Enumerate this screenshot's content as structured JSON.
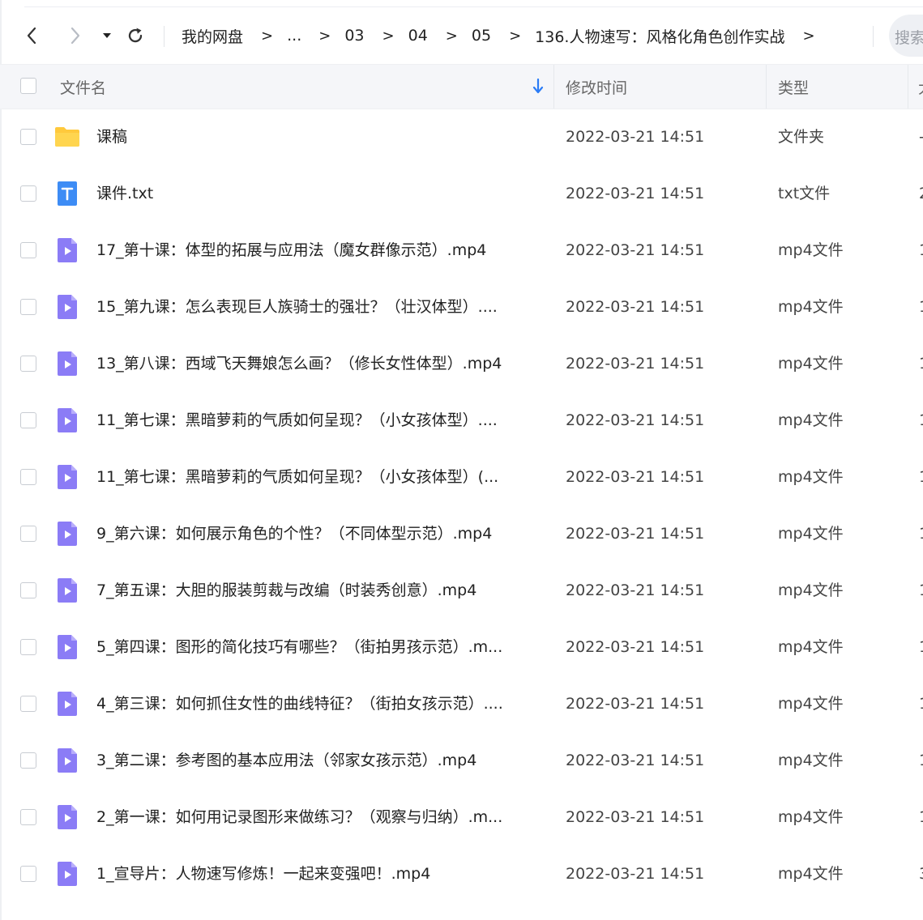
{
  "toolbar": {
    "back_icon": "chevron-left-icon",
    "forward_icon": "chevron-right-icon",
    "dropdown_icon": "caret-down-icon",
    "refresh_icon": "refresh-icon",
    "breadcrumbs": [
      {
        "label": "我的网盘"
      },
      {
        "label": "..."
      },
      {
        "label": "03"
      },
      {
        "label": "04"
      },
      {
        "label": "05"
      },
      {
        "label": "136.人物速写：风格化角色创作实战"
      }
    ],
    "separator": ">",
    "search_placeholder": "搜索"
  },
  "table": {
    "headers": {
      "name": "文件名",
      "modified": "修改时间",
      "type": "类型",
      "size": "大"
    },
    "sort_icon": "arrow-down-icon",
    "rows": [
      {
        "name": "课稿",
        "time": "2022-03-21 14:51",
        "type": "文件夹",
        "size": "-",
        "icon": "folder-icon"
      },
      {
        "name": "课件.txt",
        "time": "2022-03-21 14:51",
        "type": "txt文件",
        "size": "2",
        "icon": "text-file-icon"
      },
      {
        "name": "17_第十课：体型的拓展与应用法（魔女群像示范）.mp4",
        "time": "2022-03-21 14:51",
        "type": "mp4文件",
        "size": "1",
        "icon": "video-file-icon"
      },
      {
        "name": "15_第九课：怎么表现巨人族骑士的强壮？（壮汉体型）....",
        "time": "2022-03-21 14:51",
        "type": "mp4文件",
        "size": "1",
        "icon": "video-file-icon"
      },
      {
        "name": "13_第八课：西域飞天舞娘怎么画？（修长女性体型）.mp4",
        "time": "2022-03-21 14:51",
        "type": "mp4文件",
        "size": "1",
        "icon": "video-file-icon"
      },
      {
        "name": "11_第七课：黑暗萝莉的气质如何呈现？（小女孩体型）....",
        "time": "2022-03-21 14:51",
        "type": "mp4文件",
        "size": "1",
        "icon": "video-file-icon"
      },
      {
        "name": "11_第七课：黑暗萝莉的气质如何呈现？（小女孩体型）(...",
        "time": "2022-03-21 14:51",
        "type": "mp4文件",
        "size": "1",
        "icon": "video-file-icon"
      },
      {
        "name": "9_第六课：如何展示角色的个性？（不同体型示范）.mp4",
        "time": "2022-03-21 14:51",
        "type": "mp4文件",
        "size": "1",
        "icon": "video-file-icon"
      },
      {
        "name": "7_第五课：大胆的服装剪裁与改编（时装秀创意）.mp4",
        "time": "2022-03-21 14:51",
        "type": "mp4文件",
        "size": "1",
        "icon": "video-file-icon"
      },
      {
        "name": "5_第四课：图形的简化技巧有哪些？（街拍男孩示范）.m...",
        "time": "2022-03-21 14:51",
        "type": "mp4文件",
        "size": "1",
        "icon": "video-file-icon"
      },
      {
        "name": "4_第三课：如何抓住女性的曲线特征？（街拍女孩示范）....",
        "time": "2022-03-21 14:51",
        "type": "mp4文件",
        "size": "1",
        "icon": "video-file-icon"
      },
      {
        "name": "3_第二课：参考图的基本应用法（邻家女孩示范）.mp4",
        "time": "2022-03-21 14:51",
        "type": "mp4文件",
        "size": "1",
        "icon": "video-file-icon"
      },
      {
        "name": "2_第一课：如何用记录图形来做练习？（观察与归纳）.m...",
        "time": "2022-03-21 14:51",
        "type": "mp4文件",
        "size": "1",
        "icon": "video-file-icon"
      },
      {
        "name": "1_宣导片：人物速写修炼！一起来变强吧！.mp4",
        "time": "2022-03-21 14:51",
        "type": "mp4文件",
        "size": "3",
        "icon": "video-file-icon"
      }
    ]
  },
  "colors": {
    "folder": "#ffc93c",
    "text_file": "#3d8cf5",
    "video_file": "#8b7cf6",
    "sort_arrow": "#2b7cf6"
  }
}
